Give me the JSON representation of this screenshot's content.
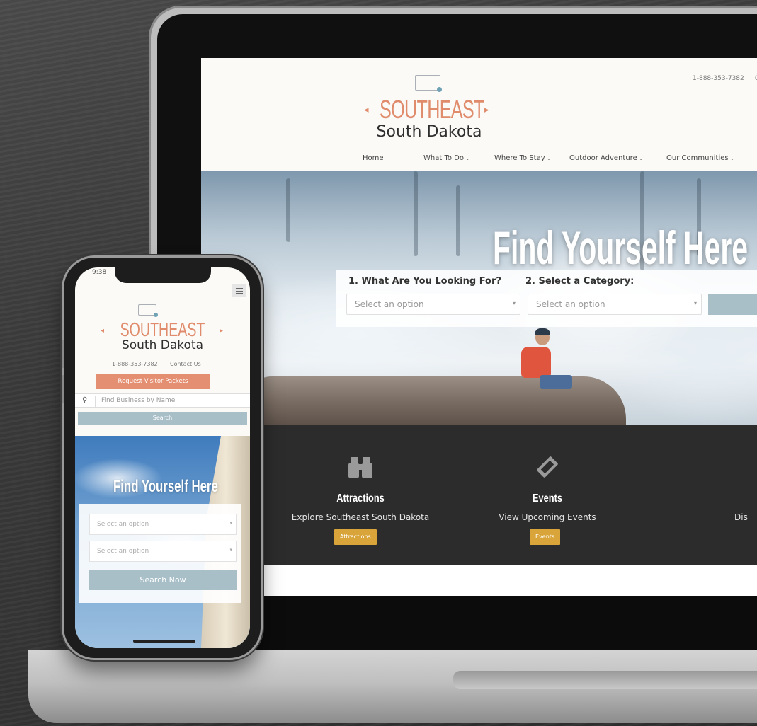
{
  "desktop": {
    "header": {
      "logo_top": "SOUTHEAST",
      "logo_bottom": "South Dakota",
      "phone": "1-888-353-7382",
      "contact_partial": "C"
    },
    "nav": [
      {
        "label": "Home",
        "has_dropdown": false
      },
      {
        "label": "What To Do",
        "has_dropdown": true
      },
      {
        "label": "Where To Stay",
        "has_dropdown": true
      },
      {
        "label": "Outdoor Adventure",
        "has_dropdown": true
      },
      {
        "label": "Our Communities",
        "has_dropdown": true
      }
    ],
    "hero": {
      "title": "Find Yourself Here",
      "step1_label": "1. What Are You Looking For?",
      "step1_placeholder": "Select an option",
      "step2_label": "2. Select a Category:",
      "step2_placeholder": "Select an option"
    },
    "features": [
      {
        "icon": "binoculars-icon",
        "title": "Attractions",
        "subtitle": "Explore Southeast South Dakota",
        "button": "Attractions"
      },
      {
        "icon": "ticket-icon",
        "title": "Events",
        "subtitle": "View Upcoming Events",
        "button": "Events"
      },
      {
        "icon": "",
        "title": "",
        "subtitle": "Dis",
        "button": ""
      }
    ],
    "colors": {
      "accent_orange": "#e08c6c",
      "feature_button": "#d9a53a",
      "search_button": "#a9bfc8",
      "features_bg": "#2c2c2c"
    }
  },
  "mobile": {
    "status_time": "9:38",
    "logo_top": "SOUTHEAST",
    "logo_bottom": "South Dakota",
    "phone": "1-888-353-7382",
    "contact": "Contact Us",
    "request_button": "Request Visitor Packets",
    "search_placeholder": "Find Business by Name",
    "search_button": "Search",
    "hero_title": "Find Yourself Here",
    "select1_placeholder": "Select an option",
    "select2_placeholder": "Select an option",
    "search_now": "Search Now",
    "colors": {
      "request_button": "#e58f72"
    }
  }
}
